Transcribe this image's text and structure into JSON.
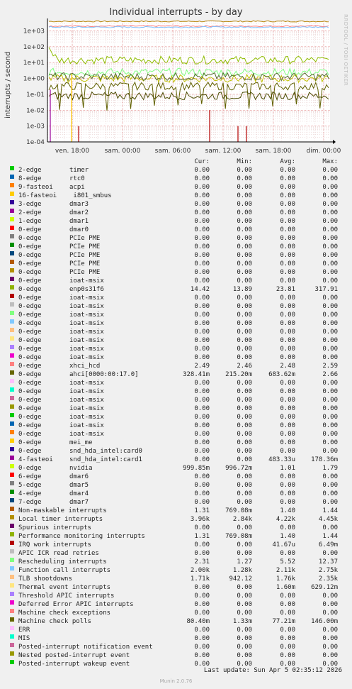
{
  "header": {
    "title": "Individual interrupts - by day",
    "ylabel": "interrupts / second",
    "vertical_label": "RRDTOOL / TOBI OETIKER"
  },
  "chart_data": {
    "type": "line",
    "title": "Individual interrupts - by day",
    "ylabel": "interrupts / second",
    "yscale": "log",
    "ylim": [
      0.0001,
      4000
    ],
    "y_ticks": [
      "1e-04",
      "1e-03",
      "1e-02",
      "1e-01",
      "1e+00",
      "1e+01",
      "1e+02",
      "1e+03"
    ],
    "x_ticks": [
      "ven. 18:00",
      "sam. 00:00",
      "sam. 06:00",
      "sam. 12:00",
      "sam. 18:00",
      "dim. 00:00"
    ],
    "series": [
      {
        "name": "Local timer interrupts",
        "color": "#b8860b",
        "level": 3960
      },
      {
        "name": "Rescheduling interrupts",
        "color": "#ff8080",
        "level": 2000
      },
      {
        "name": "Function call interrupts",
        "color": "#80c0ff",
        "level": 1710
      },
      {
        "name": "enp0s31f6",
        "color": "#8fbc00",
        "level": 14.42
      },
      {
        "name": "xhci_hcd",
        "color": "#80ff80",
        "level": 2.49
      },
      {
        "name": "0-edge nvidia",
        "color": "#c0c000",
        "level": 0.9999
      },
      {
        "name": "ahci[0000:00:17.0]",
        "color": "#606000",
        "level": 0.328
      },
      {
        "name": "Non-maskable interrupts",
        "color": "#556b2f",
        "level": 1.31
      },
      {
        "name": "Machine check polls",
        "color": "#4b4b00",
        "level": 0.0804
      }
    ]
  },
  "legend": {
    "columns": [
      "Cur:",
      "Min:",
      "Avg:",
      "Max:"
    ],
    "rows": [
      {
        "color": "#00cc00",
        "irq": "2-edge",
        "dev": "timer",
        "cur": "0.00",
        "min": "0.00",
        "avg": "0.00",
        "max": "0.00"
      },
      {
        "color": "#0066b3",
        "irq": "8-edge",
        "dev": "rtc0",
        "cur": "0.00",
        "min": "0.00",
        "avg": "0.00",
        "max": "0.00"
      },
      {
        "color": "#ff8000",
        "irq": "9-fasteoi",
        "dev": "acpi",
        "cur": "0.00",
        "min": "0.00",
        "avg": "0.00",
        "max": "0.00"
      },
      {
        "color": "#ffcc00",
        "irq": "16-fasteoi",
        "dev": " i801_smbus",
        "cur": "0.00",
        "min": "0.00",
        "avg": "0.00",
        "max": "0.00"
      },
      {
        "color": "#330099",
        "irq": "3-edge",
        "dev": "dmar3",
        "cur": "0.00",
        "min": "0.00",
        "avg": "0.00",
        "max": "0.00"
      },
      {
        "color": "#990099",
        "irq": "2-edge",
        "dev": "dmar2",
        "cur": "0.00",
        "min": "0.00",
        "avg": "0.00",
        "max": "0.00"
      },
      {
        "color": "#ccff00",
        "irq": "1-edge",
        "dev": "dmar1",
        "cur": "0.00",
        "min": "0.00",
        "avg": "0.00",
        "max": "0.00"
      },
      {
        "color": "#ff0000",
        "irq": "0-edge",
        "dev": "dmar0",
        "cur": "0.00",
        "min": "0.00",
        "avg": "0.00",
        "max": "0.00"
      },
      {
        "color": "#808080",
        "irq": "0-edge",
        "dev": "PCIe PME",
        "cur": "0.00",
        "min": "0.00",
        "avg": "0.00",
        "max": "0.00"
      },
      {
        "color": "#008f00",
        "irq": "0-edge",
        "dev": "PCIe PME",
        "cur": "0.00",
        "min": "0.00",
        "avg": "0.00",
        "max": "0.00"
      },
      {
        "color": "#00487d",
        "irq": "0-edge",
        "dev": "PCIe PME",
        "cur": "0.00",
        "min": "0.00",
        "avg": "0.00",
        "max": "0.00"
      },
      {
        "color": "#b35a00",
        "irq": "0-edge",
        "dev": "PCIe PME",
        "cur": "0.00",
        "min": "0.00",
        "avg": "0.00",
        "max": "0.00"
      },
      {
        "color": "#b38f00",
        "irq": "0-edge",
        "dev": "PCIe PME",
        "cur": "0.00",
        "min": "0.00",
        "avg": "0.00",
        "max": "0.00"
      },
      {
        "color": "#6b006b",
        "irq": "0-edge",
        "dev": "ioat-msix",
        "cur": "0.00",
        "min": "0.00",
        "avg": "0.00",
        "max": "0.00"
      },
      {
        "color": "#8fb300",
        "irq": "0-edge",
        "dev": "enp0s31f6",
        "cur": "14.42",
        "min": "13.89",
        "avg": "23.81",
        "max": "317.91"
      },
      {
        "color": "#b30000",
        "irq": "0-edge",
        "dev": "ioat-msix",
        "cur": "0.00",
        "min": "0.00",
        "avg": "0.00",
        "max": "0.00"
      },
      {
        "color": "#bebebe",
        "irq": "0-edge",
        "dev": "ioat-msix",
        "cur": "0.00",
        "min": "0.00",
        "avg": "0.00",
        "max": "0.00"
      },
      {
        "color": "#80ff80",
        "irq": "0-edge",
        "dev": "ioat-msix",
        "cur": "0.00",
        "min": "0.00",
        "avg": "0.00",
        "max": "0.00"
      },
      {
        "color": "#80c9ff",
        "irq": "0-edge",
        "dev": "ioat-msix",
        "cur": "0.00",
        "min": "0.00",
        "avg": "0.00",
        "max": "0.00"
      },
      {
        "color": "#ffc080",
        "irq": "0-edge",
        "dev": "ioat-msix",
        "cur": "0.00",
        "min": "0.00",
        "avg": "0.00",
        "max": "0.00"
      },
      {
        "color": "#ffe680",
        "irq": "0-edge",
        "dev": "ioat-msix",
        "cur": "0.00",
        "min": "0.00",
        "avg": "0.00",
        "max": "0.00"
      },
      {
        "color": "#aa80ff",
        "irq": "0-edge",
        "dev": "ioat-msix",
        "cur": "0.00",
        "min": "0.00",
        "avg": "0.00",
        "max": "0.00"
      },
      {
        "color": "#ee00cc",
        "irq": "0-edge",
        "dev": "ioat-msix",
        "cur": "0.00",
        "min": "0.00",
        "avg": "0.00",
        "max": "0.00"
      },
      {
        "color": "#ff8080",
        "irq": "0-edge",
        "dev": "xhci_hcd",
        "cur": "2.49",
        "min": "2.46",
        "avg": "2.48",
        "max": "2.59"
      },
      {
        "color": "#666600",
        "irq": "0-edge",
        "dev": "ahci[0000:00:17.0]",
        "cur": "328.41m",
        "min": "215.20m",
        "avg": "683.62m",
        "max": "2.66"
      },
      {
        "color": "#ffbfff",
        "irq": "0-edge",
        "dev": "ioat-msix",
        "cur": "0.00",
        "min": "0.00",
        "avg": "0.00",
        "max": "0.00"
      },
      {
        "color": "#00ffcc",
        "irq": "0-edge",
        "dev": "ioat-msix",
        "cur": "0.00",
        "min": "0.00",
        "avg": "0.00",
        "max": "0.00"
      },
      {
        "color": "#cc6699",
        "irq": "0-edge",
        "dev": "ioat-msix",
        "cur": "0.00",
        "min": "0.00",
        "avg": "0.00",
        "max": "0.00"
      },
      {
        "color": "#999900",
        "irq": "0-edge",
        "dev": "ioat-msix",
        "cur": "0.00",
        "min": "0.00",
        "avg": "0.00",
        "max": "0.00"
      },
      {
        "color": "#00cc00",
        "irq": "0-edge",
        "dev": "ioat-msix",
        "cur": "0.00",
        "min": "0.00",
        "avg": "0.00",
        "max": "0.00"
      },
      {
        "color": "#0066b3",
        "irq": "0-edge",
        "dev": "ioat-msix",
        "cur": "0.00",
        "min": "0.00",
        "avg": "0.00",
        "max": "0.00"
      },
      {
        "color": "#ff8000",
        "irq": "0-edge",
        "dev": "ioat-msix",
        "cur": "0.00",
        "min": "0.00",
        "avg": "0.00",
        "max": "0.00"
      },
      {
        "color": "#ffcc00",
        "irq": "0-edge",
        "dev": "mei_me",
        "cur": "0.00",
        "min": "0.00",
        "avg": "0.00",
        "max": "0.00"
      },
      {
        "color": "#330099",
        "irq": "0-edge",
        "dev": "snd_hda_intel:card0",
        "cur": "0.00",
        "min": "0.00",
        "avg": "0.00",
        "max": "0.00"
      },
      {
        "color": "#990099",
        "irq": "4-fasteoi",
        "dev": "snd_hda_intel:card1",
        "cur": "0.00",
        "min": "0.00",
        "avg": "483.33u",
        "max": "178.36m"
      },
      {
        "color": "#ccff00",
        "irq": "0-edge",
        "dev": "nvidia",
        "cur": "999.85m",
        "min": "996.72m",
        "avg": "1.01",
        "max": "1.79"
      },
      {
        "color": "#ff0000",
        "irq": "6-edge",
        "dev": "dmar6",
        "cur": "0.00",
        "min": "0.00",
        "avg": "0.00",
        "max": "0.00"
      },
      {
        "color": "#808080",
        "irq": "5-edge",
        "dev": "dmar5",
        "cur": "0.00",
        "min": "0.00",
        "avg": "0.00",
        "max": "0.00"
      },
      {
        "color": "#008f00",
        "irq": "4-edge",
        "dev": "dmar4",
        "cur": "0.00",
        "min": "0.00",
        "avg": "0.00",
        "max": "0.00"
      },
      {
        "color": "#00487d",
        "irq": "7-edge",
        "dev": "dmar7",
        "cur": "0.00",
        "min": "0.00",
        "avg": "0.00",
        "max": "0.00"
      },
      {
        "color": "#b35a00",
        "irq": "",
        "dev": "",
        "label": "Non-maskable interrupts",
        "cur": "1.31",
        "min": "769.08m",
        "avg": "1.40",
        "max": "1.44"
      },
      {
        "color": "#b38f00",
        "irq": "",
        "dev": "",
        "label": "Local timer interrupts",
        "cur": "3.96k",
        "min": "2.84k",
        "avg": "4.22k",
        "max": "4.45k"
      },
      {
        "color": "#6b006b",
        "irq": "",
        "dev": "",
        "label": "Spurious interrupts",
        "cur": "0.00",
        "min": "0.00",
        "avg": "0.00",
        "max": "0.00"
      },
      {
        "color": "#8fb300",
        "irq": "",
        "dev": "",
        "label": "Performance monitoring interrupts",
        "cur": "1.31",
        "min": "769.08m",
        "avg": "1.40",
        "max": "1.44"
      },
      {
        "color": "#b30000",
        "irq": "",
        "dev": "",
        "label": "IRQ work interrupts",
        "cur": "0.00",
        "min": "0.00",
        "avg": "41.67u",
        "max": "6.49m"
      },
      {
        "color": "#bebebe",
        "irq": "",
        "dev": "",
        "label": "APIC ICR read retries",
        "cur": "0.00",
        "min": "0.00",
        "avg": "0.00",
        "max": "0.00"
      },
      {
        "color": "#80ff80",
        "irq": "",
        "dev": "",
        "label": "Rescheduling interrupts",
        "cur": "2.31",
        "min": "1.27",
        "avg": "5.52",
        "max": "12.37"
      },
      {
        "color": "#80c9ff",
        "irq": "",
        "dev": "",
        "label": "Function call interrupts",
        "cur": "2.00k",
        "min": "1.28k",
        "avg": "2.11k",
        "max": "2.75k"
      },
      {
        "color": "#ffc080",
        "irq": "",
        "dev": "",
        "label": "TLB shootdowns",
        "cur": "1.71k",
        "min": "942.12",
        "avg": "1.76k",
        "max": "2.35k"
      },
      {
        "color": "#ffe680",
        "irq": "",
        "dev": "",
        "label": "Thermal event interrupts",
        "cur": "0.00",
        "min": "0.00",
        "avg": "1.60m",
        "max": "629.12m"
      },
      {
        "color": "#aa80ff",
        "irq": "",
        "dev": "",
        "label": "Threshold APIC interrupts",
        "cur": "0.00",
        "min": "0.00",
        "avg": "0.00",
        "max": "0.00"
      },
      {
        "color": "#ee00cc",
        "irq": "",
        "dev": "",
        "label": "Deferred Error APIC interrupts",
        "cur": "0.00",
        "min": "0.00",
        "avg": "0.00",
        "max": "0.00"
      },
      {
        "color": "#ff8080",
        "irq": "",
        "dev": "",
        "label": "Machine check exceptions",
        "cur": "0.00",
        "min": "0.00",
        "avg": "0.00",
        "max": "0.00"
      },
      {
        "color": "#666600",
        "irq": "",
        "dev": "",
        "label": "Machine check polls",
        "cur": "80.40m",
        "min": "1.33m",
        "avg": "77.21m",
        "max": "146.00m"
      },
      {
        "color": "#ffbfff",
        "irq": "",
        "dev": "",
        "label": "ERR",
        "cur": "0.00",
        "min": "0.00",
        "avg": "0.00",
        "max": "0.00"
      },
      {
        "color": "#00ffcc",
        "irq": "",
        "dev": "",
        "label": "MIS",
        "cur": "0.00",
        "min": "0.00",
        "avg": "0.00",
        "max": "0.00"
      },
      {
        "color": "#cc6699",
        "irq": "",
        "dev": "",
        "label": "Posted-interrupt notification event",
        "cur": "0.00",
        "min": "0.00",
        "avg": "0.00",
        "max": "0.00"
      },
      {
        "color": "#999900",
        "irq": "",
        "dev": "",
        "label": "Nested posted-interrupt event",
        "cur": "0.00",
        "min": "0.00",
        "avg": "0.00",
        "max": "0.00"
      },
      {
        "color": "#00cc00",
        "irq": "",
        "dev": "",
        "label": "Posted-interrupt wakeup event",
        "cur": "0.00",
        "min": "0.00",
        "avg": "0.00",
        "max": "0.00"
      }
    ]
  },
  "footer": {
    "last_update": "Last update: Sun Apr  5 02:35:12 2026",
    "version": "Munin 2.0.76"
  }
}
